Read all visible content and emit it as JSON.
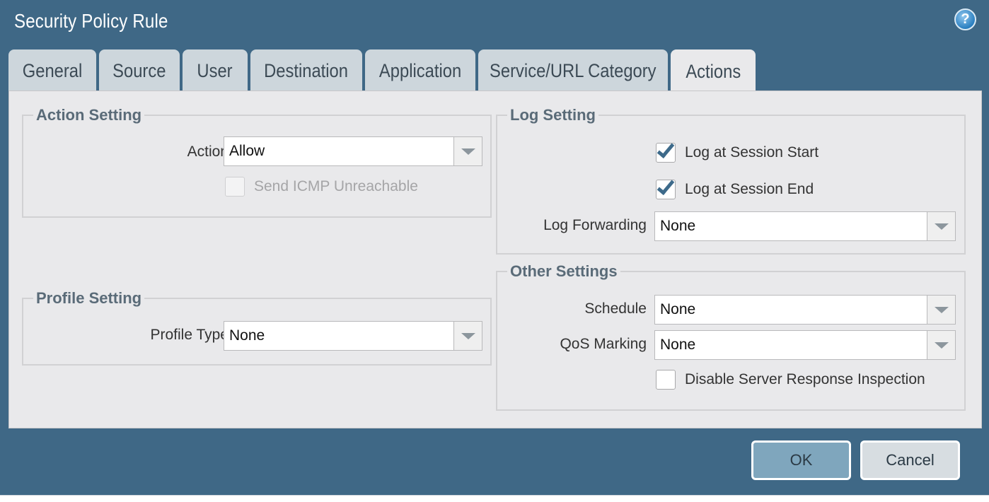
{
  "dialog": {
    "title": "Security Policy Rule",
    "help_icon": "help-icon"
  },
  "tabs": [
    {
      "label": "General",
      "active": false
    },
    {
      "label": "Source",
      "active": false
    },
    {
      "label": "User",
      "active": false
    },
    {
      "label": "Destination",
      "active": false
    },
    {
      "label": "Application",
      "active": false
    },
    {
      "label": "Service/URL Category",
      "active": false
    },
    {
      "label": "Actions",
      "active": true
    }
  ],
  "action_setting": {
    "title": "Action Setting",
    "action_label": "Action",
    "action_value": "Allow",
    "send_icmp_label": "Send ICMP Unreachable",
    "send_icmp_checked": false,
    "send_icmp_disabled": true
  },
  "profile_setting": {
    "title": "Profile Setting",
    "profile_type_label": "Profile Type",
    "profile_type_value": "None"
  },
  "log_setting": {
    "title": "Log Setting",
    "log_start_label": "Log at Session Start",
    "log_start_checked": true,
    "log_end_label": "Log at Session End",
    "log_end_checked": true,
    "log_forwarding_label": "Log Forwarding",
    "log_forwarding_value": "None"
  },
  "other_settings": {
    "title": "Other Settings",
    "schedule_label": "Schedule",
    "schedule_value": "None",
    "qos_label": "QoS Marking",
    "qos_value": "None",
    "disable_srv_label": "Disable Server Response Inspection",
    "disable_srv_checked": false
  },
  "buttons": {
    "ok": "OK",
    "cancel": "Cancel"
  },
  "colors": {
    "dialog_bg": "#3f6886",
    "panel_bg": "#e9e9eb",
    "tab_inactive": "#cdd6dc",
    "check_accent": "#3d6a8a",
    "ok_button": "#7fa6bd"
  }
}
